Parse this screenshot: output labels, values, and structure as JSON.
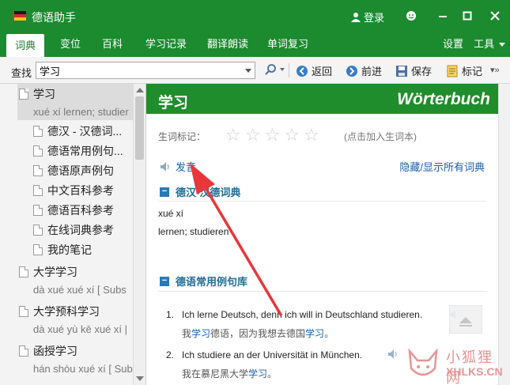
{
  "app": {
    "title": "德语助手",
    "login_label": "登录"
  },
  "tabs": [
    {
      "label": "词典"
    },
    {
      "label": "变位"
    },
    {
      "label": "百科"
    },
    {
      "label": "学习记录"
    },
    {
      "label": "翻译朗读"
    },
    {
      "label": "单词复习"
    }
  ],
  "menu_right": {
    "settings": "设置",
    "tools": "工具"
  },
  "toolbar": {
    "search_label": "查找",
    "search_value": "学习",
    "back": "返回",
    "forward": "前进",
    "save": "保存",
    "bookmark": "标记"
  },
  "sidebar": {
    "entries": [
      {
        "word": "学习",
        "pinyin": "xué xí lernen; studier"
      },
      {
        "word": "德汉 - 汉德词..."
      },
      {
        "word": "德语常用例句..."
      },
      {
        "word": "德语原声例句"
      },
      {
        "word": "中文百科参考"
      },
      {
        "word": "德语百科参考"
      },
      {
        "word": "在线词典参考"
      },
      {
        "word": "我的笔记"
      },
      {
        "word": "大学学习",
        "pinyin": "dà xué xué xí [ Subs"
      },
      {
        "word": "大学预科学习",
        "pinyin": "dà xué yù kē xué xí |"
      },
      {
        "word": "函授学习",
        "pinyin": "hán shòu xué xí [ Sub"
      }
    ]
  },
  "content": {
    "word": "学习",
    "brand": "Wörterbuch",
    "rating_label": "生词标记：",
    "rating_stars": 0,
    "rating_hint": "(点击加入生词本)",
    "pronounce_label": "发音",
    "toggle_all": "隐藏/显示所有词典",
    "section1": {
      "title": "德汉-汉德词典",
      "line1": "xué xí",
      "line2": "lernen; studieren"
    },
    "section2": {
      "title": "德语常用例句库",
      "examples": [
        {
          "num": "1.",
          "en": "Ich lerne Deutsch, denn ich will in Deutschland studieren.",
          "zh_pre": "我",
          "zh_hl": "学习",
          "zh_mid": "德语，因为我想去德国",
          "zh_hl2": "学习",
          "zh_post": "。"
        },
        {
          "num": "2.",
          "en": "Ich studiere an der Universität in München.",
          "zh_pre": "我在慕尼黑大学",
          "zh_hl": "学习",
          "zh_mid": "。",
          "zh_hl2": "",
          "zh_post": ""
        }
      ]
    }
  },
  "watermark": {
    "text_cn": "小狐狸网",
    "text_en": "XHLKS.CN"
  },
  "colors": {
    "brand_green": "#1c8a2f",
    "link_blue": "#1a5fa8",
    "arrow_red": "#e8363a"
  }
}
